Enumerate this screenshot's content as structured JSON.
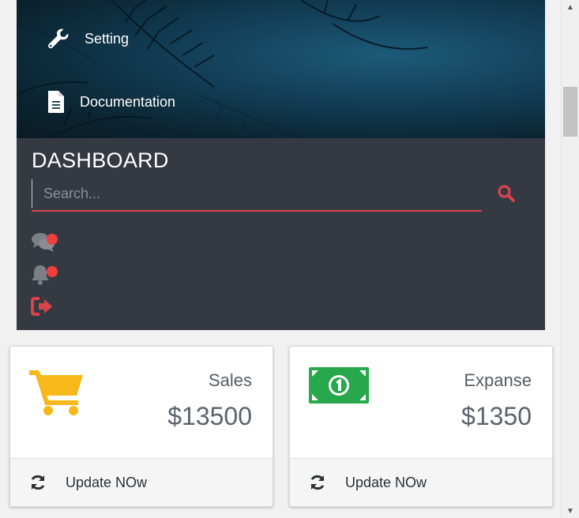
{
  "sidebar": {
    "menu": [
      {
        "label": "Setting",
        "icon": "wrench-icon"
      },
      {
        "label": "Documentation",
        "icon": "document-icon"
      }
    ],
    "title": "DASHBOARD",
    "search": {
      "placeholder": "Search...",
      "value": "",
      "icon": "search-icon"
    },
    "status_icons": [
      "chat-icon",
      "bell-icon",
      "logout-icon"
    ]
  },
  "cards": [
    {
      "label": "Sales",
      "value": "$13500",
      "icon": "shopping-cart-icon",
      "footer": "Update NOw",
      "footer_icon": "refresh-icon"
    },
    {
      "label": "Expanse",
      "value": "$1350",
      "icon": "money-bill-icon",
      "footer": "Update NOw",
      "footer_icon": "refresh-icon"
    }
  ],
  "colors": {
    "accent": "#d9434b",
    "sidebar_bg": "#353a42",
    "notification_dot": "#f03e3e",
    "cart": "#f9b819",
    "money": "#27a84a"
  }
}
